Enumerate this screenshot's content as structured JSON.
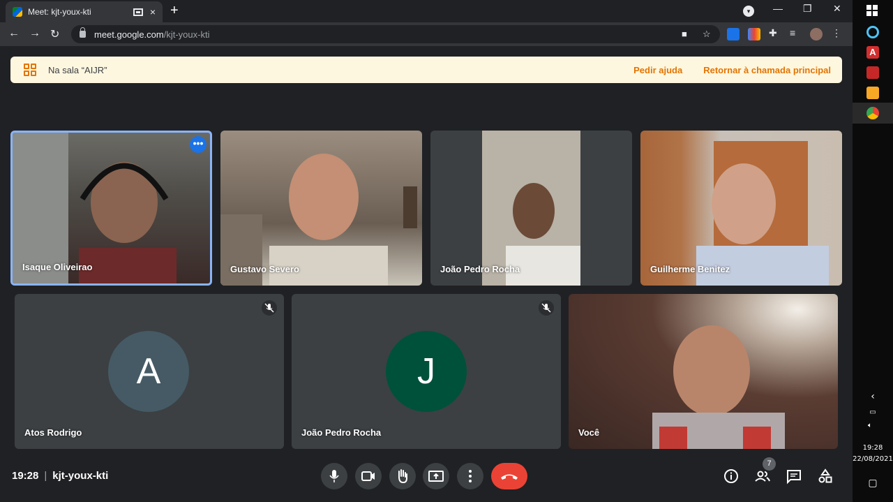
{
  "browser": {
    "tab_title": "Meet: kjt-youx-kti",
    "tab_close": "×",
    "new_tab": "+",
    "url_host": "meet.google.com",
    "url_path": "/kjt-youx-kti",
    "window_controls": [
      "minimize",
      "restore",
      "close"
    ]
  },
  "banner": {
    "room_label": "Na sala “AIJR”",
    "help_label": "Pedir ajuda",
    "return_label": "Retornar à chamada principal"
  },
  "participants": [
    {
      "name": "Isaque Oliveirao",
      "active": true
    },
    {
      "name": "Gustavo Severo"
    },
    {
      "name": "João Pedro Rocha"
    },
    {
      "name": "Guilherme Benitez"
    },
    {
      "name": "Atos Rodrigo",
      "initial": "A",
      "avatar_color": "#455a64",
      "muted": true
    },
    {
      "name": "João Pedro Rocha",
      "initial": "J",
      "avatar_color": "#00513a",
      "muted": true
    },
    {
      "name": "Você"
    }
  ],
  "meeting": {
    "time": "19:28",
    "separator": "|",
    "code": "kjt-youx-kti",
    "participant_count": "7"
  },
  "controls": [
    "mic-icon",
    "camera-icon",
    "raise-hand-icon",
    "present-icon",
    "more-options-icon",
    "hangup-icon"
  ],
  "right_controls": [
    "info-icon",
    "people-icon",
    "chat-icon",
    "activities-icon"
  ],
  "taskbar": {
    "clock_time": "19:28",
    "clock_date": "22/08/2021"
  },
  "colors": {
    "background": "#202124",
    "banner": "#fef7e0",
    "banner_accent": "#e37400",
    "active_border": "#8ab4f8",
    "hangup": "#ea4335"
  }
}
